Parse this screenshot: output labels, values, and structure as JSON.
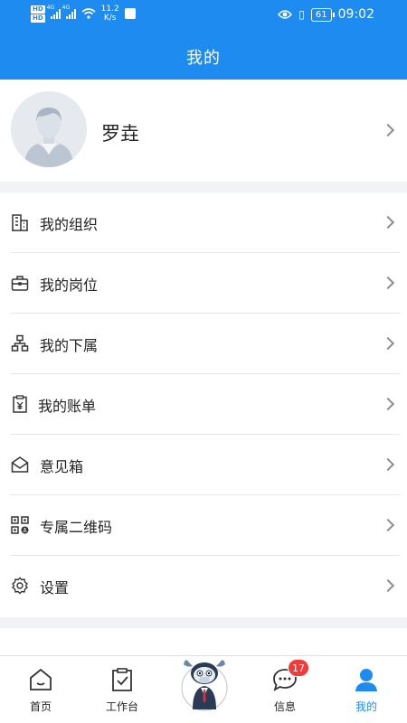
{
  "status_bar": {
    "network_speed": "11.2",
    "speed_unit": "K/s",
    "battery": "61",
    "time": "09:02"
  },
  "header": {
    "title": "我的"
  },
  "profile": {
    "name": "罗垚"
  },
  "menu": {
    "items": [
      {
        "label": "我的组织",
        "icon": "building-icon"
      },
      {
        "label": "我的岗位",
        "icon": "briefcase-icon"
      },
      {
        "label": "我的下属",
        "icon": "org-chart-icon"
      },
      {
        "label": "我的账单",
        "icon": "bill-icon"
      },
      {
        "label": "意见箱",
        "icon": "envelope-icon"
      },
      {
        "label": "专属二维码",
        "icon": "qr-code-icon"
      },
      {
        "label": "设置",
        "icon": "gear-icon"
      }
    ]
  },
  "tabbar": {
    "items": [
      {
        "label": "首页",
        "icon": "home-icon"
      },
      {
        "label": "工作台",
        "icon": "clipboard-icon"
      },
      {
        "label": "",
        "icon": "mascot-icon"
      },
      {
        "label": "信息",
        "icon": "chat-icon",
        "badge": "17"
      },
      {
        "label": "我的",
        "icon": "person-icon",
        "active": true
      }
    ]
  },
  "colors": {
    "accent": "#1e8bf0",
    "badge": "#f23a3a"
  }
}
